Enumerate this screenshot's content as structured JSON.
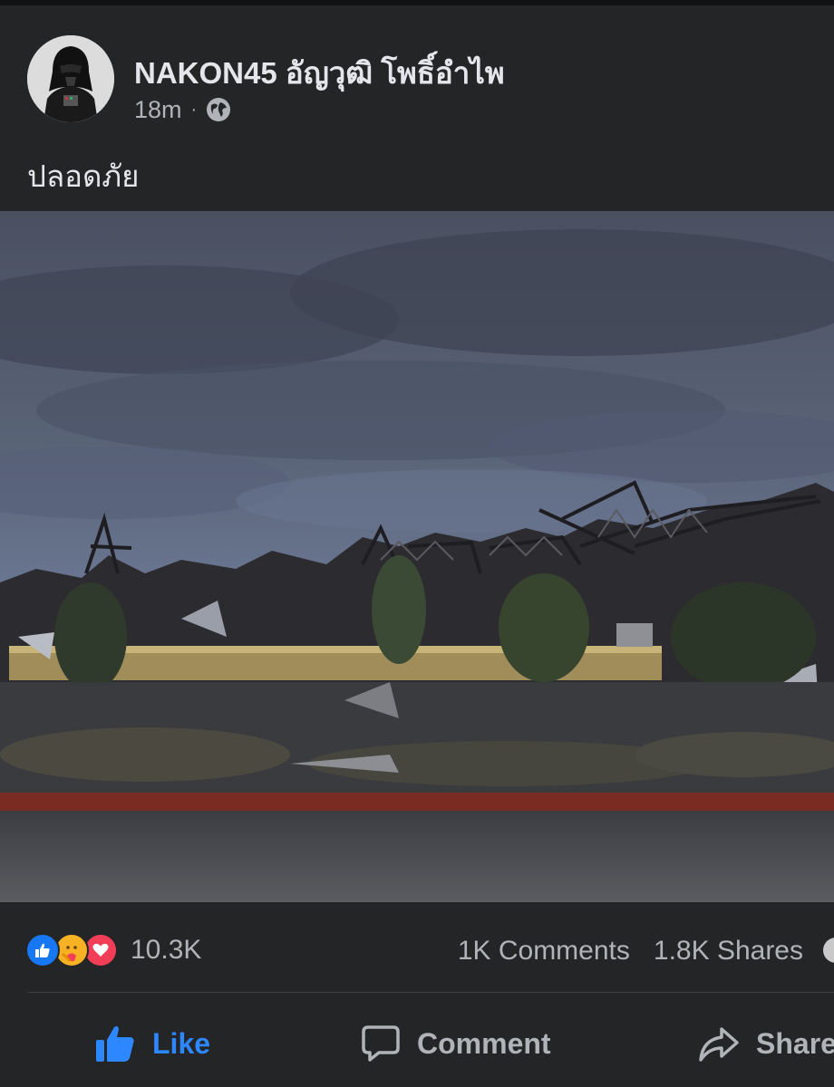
{
  "post": {
    "author": "NAKON45 อัญวุฒิ โพธิ์อำไพ",
    "timestamp": "18m",
    "separator": "·",
    "audience_icon": "globe-icon",
    "text": "ปลอดภัย",
    "photo_subject": "collapsed building debris under cloudy sky"
  },
  "reactions": {
    "icons": [
      "like-reaction-icon",
      "care-reaction-icon",
      "love-reaction-icon"
    ],
    "count": "10.3K"
  },
  "stats": {
    "comments": "1K Comments",
    "shares": "1.8K Shares"
  },
  "actions": {
    "like": "Like",
    "comment": "Comment",
    "share": "Share"
  },
  "colors": {
    "background": "#242526",
    "like_blue": "#2d88ff",
    "text_primary": "#e4e6eb",
    "text_secondary": "#b0b3b8"
  }
}
